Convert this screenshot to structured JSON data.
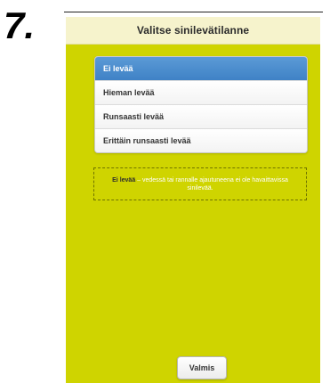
{
  "step_number": "7.",
  "header": {
    "title": "Valitse sinilevätilanne"
  },
  "options": [
    {
      "label": "Ei levää",
      "selected": true
    },
    {
      "label": "Hieman levää",
      "selected": false
    },
    {
      "label": "Runsaasti levää",
      "selected": false
    },
    {
      "label": "Erittäin runsaasti levää",
      "selected": false
    }
  ],
  "info": {
    "term": "Ei levää",
    "description": " – vedessä tai rannalle ajautuneena ei ole havaittavissa sinilevää."
  },
  "done_button": {
    "label": "Valmis"
  },
  "colors": {
    "background_green": "#cfd400",
    "header_bg": "#f6f3cc",
    "selected_blue": "#4a8ccf",
    "info_text": "#ffffff"
  }
}
